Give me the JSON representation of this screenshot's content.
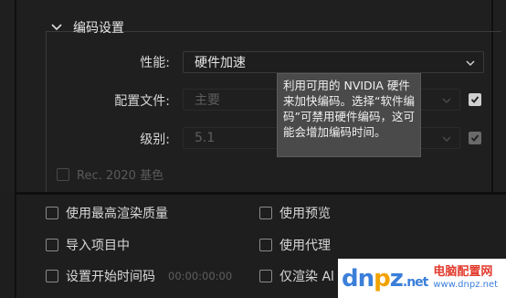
{
  "section": {
    "title": "编码设置"
  },
  "performance": {
    "label": "性能:",
    "value": "硬件加速"
  },
  "profile": {
    "label": "配置文件:",
    "value": "主要"
  },
  "level": {
    "label": "级别:",
    "value": "5.1"
  },
  "rec2020": {
    "label": "Rec. 2020 基色"
  },
  "tooltip": {
    "text": "利用可用的 NVIDIA 硬件来加快编码。选择“软件编码”可禁用硬件编码，这可能会增加编码时间。"
  },
  "options": {
    "max_render_quality": "使用最高渲染质量",
    "use_preview": "使用预览",
    "import_project": "导入项目中",
    "use_proxy": "使用代理",
    "set_start_timecode": "设置开始时间码",
    "start_timecode_value": "00:00:00:00",
    "render_alpha_only": "仅渲染 Al"
  },
  "watermark": {
    "logo_a": "dn",
    "logo_b": "p",
    "logo_c": "z",
    "logo_d": ".net",
    "cn": "电脑配置网",
    "url": "www.dnpz.net"
  }
}
